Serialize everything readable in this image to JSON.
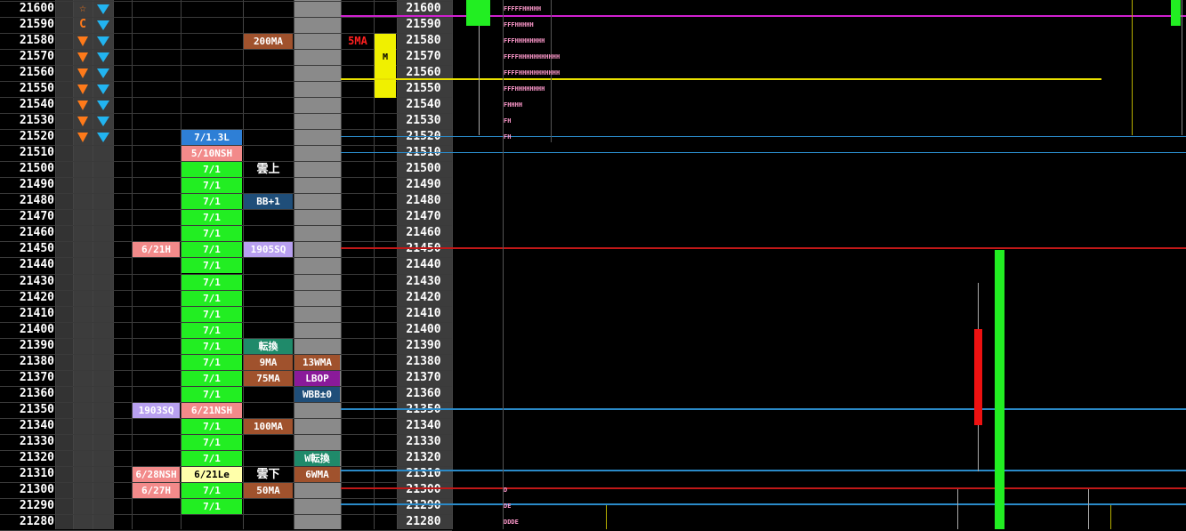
{
  "prices": [
    "21600",
    "21590",
    "21580",
    "21570",
    "21560",
    "21550",
    "21540",
    "21530",
    "21520",
    "21510",
    "21500",
    "21490",
    "21480",
    "21470",
    "21460",
    "21450",
    "21440",
    "21430",
    "21420",
    "21410",
    "21400",
    "21390",
    "21380",
    "21370",
    "21360",
    "21350",
    "21340",
    "21330",
    "21320",
    "21310",
    "21300",
    "21290",
    "21280"
  ],
  "signals": {
    "star_row": "☆",
    "c_row": "C",
    "arrow_rows": [
      "21580",
      "21570",
      "21560",
      "21550",
      "21540",
      "21530",
      "21520"
    ],
    "blue_rows": [
      "21600",
      "21590",
      "21580",
      "21570",
      "21560",
      "21550",
      "21540",
      "21530",
      "21520"
    ]
  },
  "col_left": [
    {
      "row": 15,
      "text": "6/21H",
      "color": "#f28a8a"
    },
    {
      "row": 25,
      "text": "1903SQ",
      "color": "#b8a0f0"
    },
    {
      "row": 29,
      "text": "6/28NSH",
      "color": "#f28a8a"
    },
    {
      "row": 30,
      "text": "6/27H",
      "color": "#f28a8a"
    }
  ],
  "col_mid": [
    {
      "row": 8,
      "text": "7/1.3L",
      "color": "#2e7fd6"
    },
    {
      "row": 9,
      "text": "5/10NSH",
      "color": "#f28a8a"
    },
    {
      "row": 10,
      "text": "7/1",
      "color": "#22ee22"
    },
    {
      "row": 11,
      "text": "7/1",
      "color": "#22ee22"
    },
    {
      "row": 12,
      "text": "7/1",
      "color": "#22ee22"
    },
    {
      "row": 13,
      "text": "7/1",
      "color": "#22ee22"
    },
    {
      "row": 14,
      "text": "7/1",
      "color": "#22ee22"
    },
    {
      "row": 15,
      "text": "7/1",
      "color": "#22ee22"
    },
    {
      "row": 16,
      "text": "7/1",
      "color": "#22ee22"
    },
    {
      "row": 17,
      "text": "7/1",
      "color": "#22ee22"
    },
    {
      "row": 18,
      "text": "7/1",
      "color": "#22ee22"
    },
    {
      "row": 19,
      "text": "7/1",
      "color": "#22ee22"
    },
    {
      "row": 20,
      "text": "7/1",
      "color": "#22ee22"
    },
    {
      "row": 21,
      "text": "7/1",
      "color": "#22ee22"
    },
    {
      "row": 22,
      "text": "7/1",
      "color": "#22ee22"
    },
    {
      "row": 23,
      "text": "7/1",
      "color": "#22ee22"
    },
    {
      "row": 24,
      "text": "7/1",
      "color": "#22ee22"
    },
    {
      "row": 25,
      "text": "6/21NSH",
      "color": "#f28a8a"
    },
    {
      "row": 26,
      "text": "7/1",
      "color": "#22ee22"
    },
    {
      "row": 27,
      "text": "7/1",
      "color": "#22ee22"
    },
    {
      "row": 28,
      "text": "7/1",
      "color": "#22ee22"
    },
    {
      "row": 29,
      "text": "6/21Le",
      "color": "#ffffaa",
      "fg": "#000"
    },
    {
      "row": 30,
      "text": "7/1",
      "color": "#22ee22"
    },
    {
      "row": 31,
      "text": "7/1",
      "color": "#22ee22"
    }
  ],
  "col_ma": [
    {
      "row": 2,
      "text": "200MA",
      "color": "#a0522d"
    },
    {
      "row": 10,
      "text": "雲上",
      "color": "none"
    },
    {
      "row": 12,
      "text": "BB+1",
      "color": "#1f4e79"
    },
    {
      "row": 15,
      "text": "1905SQ",
      "color": "#b8a0f0"
    },
    {
      "row": 21,
      "text": "転換",
      "color": "#1f8a6a"
    },
    {
      "row": 22,
      "text": "9MA",
      "color": "#a0522d"
    },
    {
      "row": 23,
      "text": "75MA",
      "color": "#a0522d"
    },
    {
      "row": 26,
      "text": "100MA",
      "color": "#a0522d"
    },
    {
      "row": 29,
      "text": "雲下",
      "color": "none"
    },
    {
      "row": 30,
      "text": "50MA",
      "color": "#a0522d"
    }
  ],
  "col_w": [
    {
      "row": 22,
      "text": "13WMA",
      "color": "#a0522d"
    },
    {
      "row": 23,
      "text": "LBOP",
      "color": "#8a1a9a"
    },
    {
      "row": 24,
      "text": "WBB±0",
      "color": "#1f4e79"
    },
    {
      "row": 28,
      "text": "W転換",
      "color": "#1f8a6a"
    },
    {
      "row": 29,
      "text": "6WMA",
      "color": "#a0522d"
    }
  ],
  "ma5_label": "5MA",
  "m_label": "M",
  "profile": [
    {
      "row": 0,
      "text": "FFFFFHHHHH"
    },
    {
      "row": 1,
      "text": "FFFHHHHH"
    },
    {
      "row": 2,
      "text": "FFFHHHHHHHH"
    },
    {
      "row": 3,
      "text": "FFFFHHHHHHHHHHH"
    },
    {
      "row": 4,
      "text": "FFFFHHHHHHHHHHH"
    },
    {
      "row": 5,
      "text": "FFFHHHHHHHH"
    },
    {
      "row": 6,
      "text": "FHHHH"
    },
    {
      "row": 7,
      "text": "FH"
    },
    {
      "row": 8,
      "text": "FH"
    },
    {
      "row": 30,
      "text": "D"
    },
    {
      "row": 31,
      "text": "DE"
    },
    {
      "row": 32,
      "text": "DDDE"
    }
  ]
}
